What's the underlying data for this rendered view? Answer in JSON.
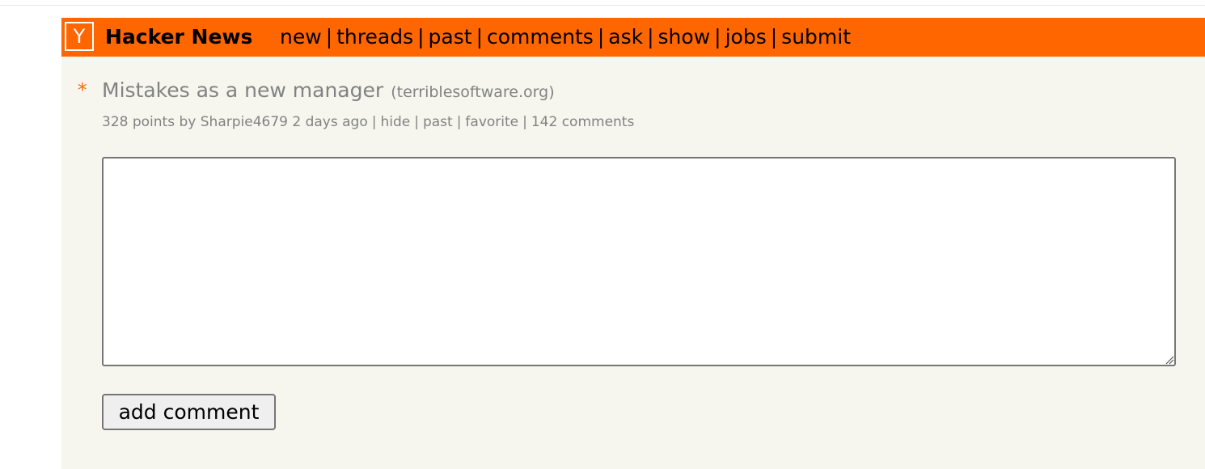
{
  "header": {
    "logo": "Y",
    "brand": "Hacker News",
    "nav": [
      "new",
      "threads",
      "past",
      "comments",
      "ask",
      "show",
      "jobs",
      "submit"
    ],
    "separator": "|"
  },
  "story": {
    "marker": "*",
    "title": "Mistakes as a new manager",
    "site": "(terriblesoftware.org)",
    "points": "328 points",
    "by_label": "by",
    "user": "Sharpie4679",
    "age": "2 days ago",
    "hide": "hide",
    "past": "past",
    "favorite": "favorite",
    "comments": "142 comments"
  },
  "comment_form": {
    "text": "",
    "button_label": "add comment"
  },
  "colors": {
    "header_bg": "#ff6600",
    "page_bg": "#f6f6ef",
    "subtext": "#828282"
  }
}
